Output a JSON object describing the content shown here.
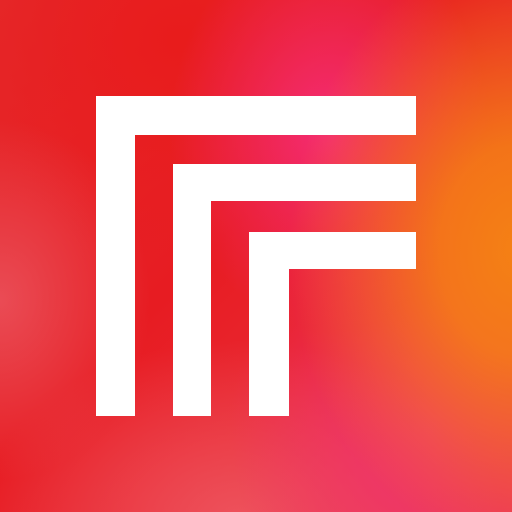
{
  "icon": {
    "name": "stacked-f-logo",
    "colors": {
      "primary_red": "#e51d24",
      "pink": "#f62e7e",
      "orange": "#f58114",
      "coral": "#ea505a",
      "mark": "#ffffff"
    }
  }
}
